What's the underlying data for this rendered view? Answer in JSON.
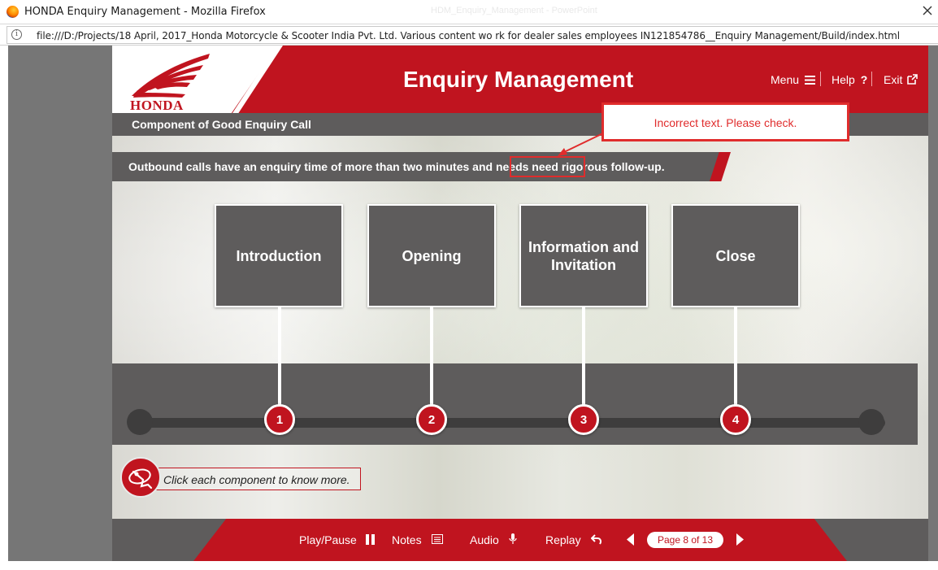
{
  "browser": {
    "window_title": "HONDA Enquiry Management - Mozilla Firefox",
    "background_title": "HDM_Enquiry_Management - PowerPoint",
    "url": "file:///D:/Projects/18 April, 2017_Honda Motorcycle & Scooter India Pvt. Ltd. Various content wo rk for dealer sales employees IN121854786__Enquiry Management/Build/index.html"
  },
  "header": {
    "logo_text": "HONDA",
    "title": "Enquiry Management",
    "menu_label": "Menu",
    "help_label": "Help",
    "exit_label": "Exit"
  },
  "section": {
    "title": "Component of Good Enquiry Call",
    "statement": "Outbound calls have an enquiry time of more than two minutes and needs need rigorous follow-up."
  },
  "components": [
    {
      "number": "1",
      "label": "Introduction"
    },
    {
      "number": "2",
      "label": "Opening"
    },
    {
      "number": "3",
      "label": "Information and Invitation"
    },
    {
      "number": "4",
      "label": "Close"
    }
  ],
  "hint": {
    "text": "Click each component to know more."
  },
  "footer": {
    "play_pause_label": "Play/Pause",
    "notes_label": "Notes",
    "audio_label": "Audio",
    "replay_label": "Replay",
    "page_indicator": "Page 8 of 13"
  },
  "review": {
    "callout_text": "Incorrect text. Please check."
  },
  "colors": {
    "brand_red": "#c0141f",
    "panel_gray": "#5e5c5c",
    "annotation_red": "#e02c2c"
  }
}
